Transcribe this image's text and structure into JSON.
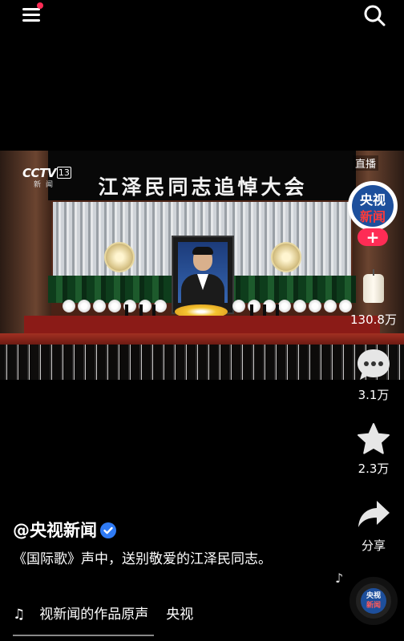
{
  "topbar": {
    "menu_icon": "menu-icon",
    "search_icon": "search-icon",
    "notification_color": "#ff2b55"
  },
  "video": {
    "channel_logo": "CCTV",
    "channel_number": "13",
    "channel_sub": "新闻",
    "live_label": "直播",
    "banner_text": "江泽民同志追悼大会"
  },
  "sidebar": {
    "avatar_line1": "央视",
    "avatar_line2": "新闻",
    "follow_label": "+",
    "candle_count": "130.8万",
    "comment_count": "3.1万",
    "favorite_count": "2.3万",
    "share_label": "分享"
  },
  "post": {
    "username": "@央视新闻",
    "verified_icon": "verified-check-icon",
    "description": "《国际歌》声中，送别敬爱的江泽民同志。",
    "music_text": "视新闻的作品原声",
    "music_author": "央视"
  },
  "disc": {
    "line1": "央视",
    "line2": "新闻"
  },
  "colors": {
    "accent": "#fe2c55",
    "verified": "#2f7bf5",
    "brand_blue": "#1d4f9c"
  }
}
